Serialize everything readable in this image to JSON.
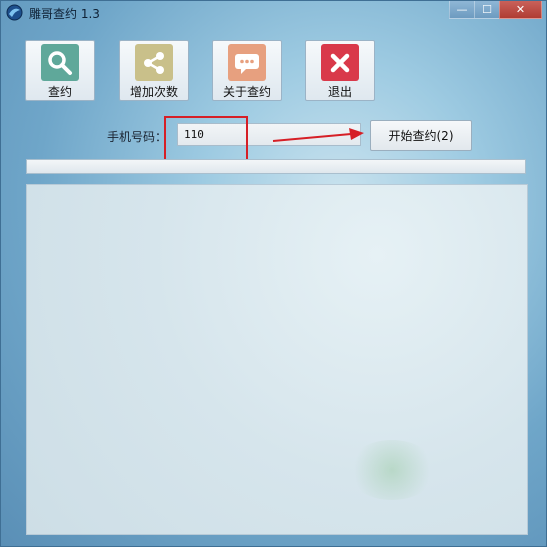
{
  "window": {
    "title": "雕哥查约 1.3"
  },
  "window_controls": {
    "minimize": "—",
    "maximize": "☐",
    "close": "✕"
  },
  "toolbar": {
    "items": [
      {
        "label": "查约",
        "icon": "search-icon",
        "color": "#5fa89a"
      },
      {
        "label": "增加次数",
        "icon": "share-icon",
        "color": "#c9c08a"
      },
      {
        "label": "关于查约",
        "icon": "chat-bubble-icon",
        "color": "#e7a07f"
      },
      {
        "label": "退出",
        "icon": "close-icon",
        "color": "#d9394a"
      }
    ]
  },
  "form": {
    "phone_label": "手机号码：",
    "phone_value": "110",
    "start_button": "开始查约(2)"
  },
  "annotation_colors": {
    "highlight": "#d61f26"
  }
}
